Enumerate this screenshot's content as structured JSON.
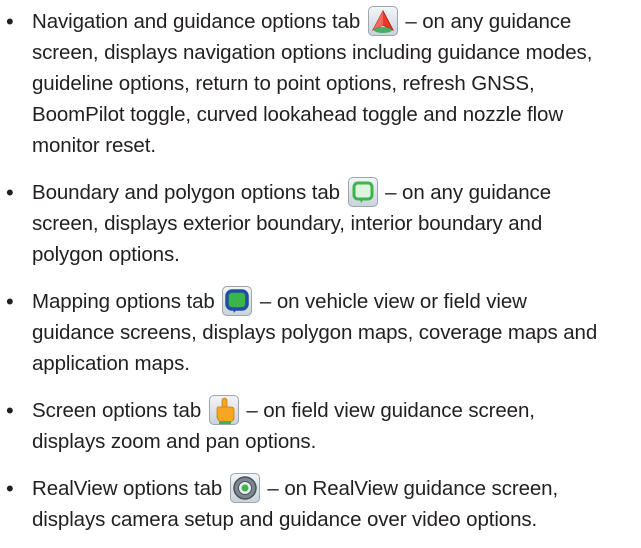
{
  "items": [
    {
      "bullet": "•",
      "icon": "navigation-tab-icon",
      "lines": [
        {
          "before": "Navigation and guidance options tab ",
          "after": " – on any guidance"
        },
        {
          "text": "screen, displays navigation options including guidance modes,"
        },
        {
          "text": "guideline options, return to point options, refresh GNSS,"
        },
        {
          "text": "BoomPilot toggle, curved lookahead toggle and nozzle flow"
        },
        {
          "text": "monitor reset."
        }
      ]
    },
    {
      "bullet": "•",
      "icon": "boundary-tab-icon",
      "lines": [
        {
          "before": "Boundary and polygon options tab ",
          "after": " – on any guidance"
        },
        {
          "text": "screen, displays exterior boundary, interior boundary and"
        },
        {
          "text": "polygon options."
        }
      ]
    },
    {
      "bullet": "•",
      "icon": "mapping-tab-icon",
      "lines": [
        {
          "before": "Mapping options tab ",
          "after": " – on vehicle view or field view"
        },
        {
          "text": "guidance screens, displays polygon maps, coverage maps and"
        },
        {
          "text": "application maps."
        }
      ]
    },
    {
      "bullet": "•",
      "icon": "screen-tab-icon",
      "lines": [
        {
          "before": "Screen options tab ",
          "after": " – on field view guidance screen,"
        },
        {
          "text": "displays zoom and pan options."
        }
      ]
    },
    {
      "bullet": "•",
      "icon": "realview-tab-icon",
      "lines": [
        {
          "before": "RealView options tab ",
          "after": " – on RealView guidance screen,"
        },
        {
          "text": "displays camera setup and guidance over video options."
        }
      ]
    }
  ],
  "icon_colors": {
    "navigation": "#e8392b",
    "navigation_accent": "#2fa84f",
    "boundary": "#3bb54a",
    "mapping": "#1f4fa3",
    "mapping_fill": "#3bb54a",
    "screen_hand": "#f6a623",
    "realview": "#5a6470"
  }
}
